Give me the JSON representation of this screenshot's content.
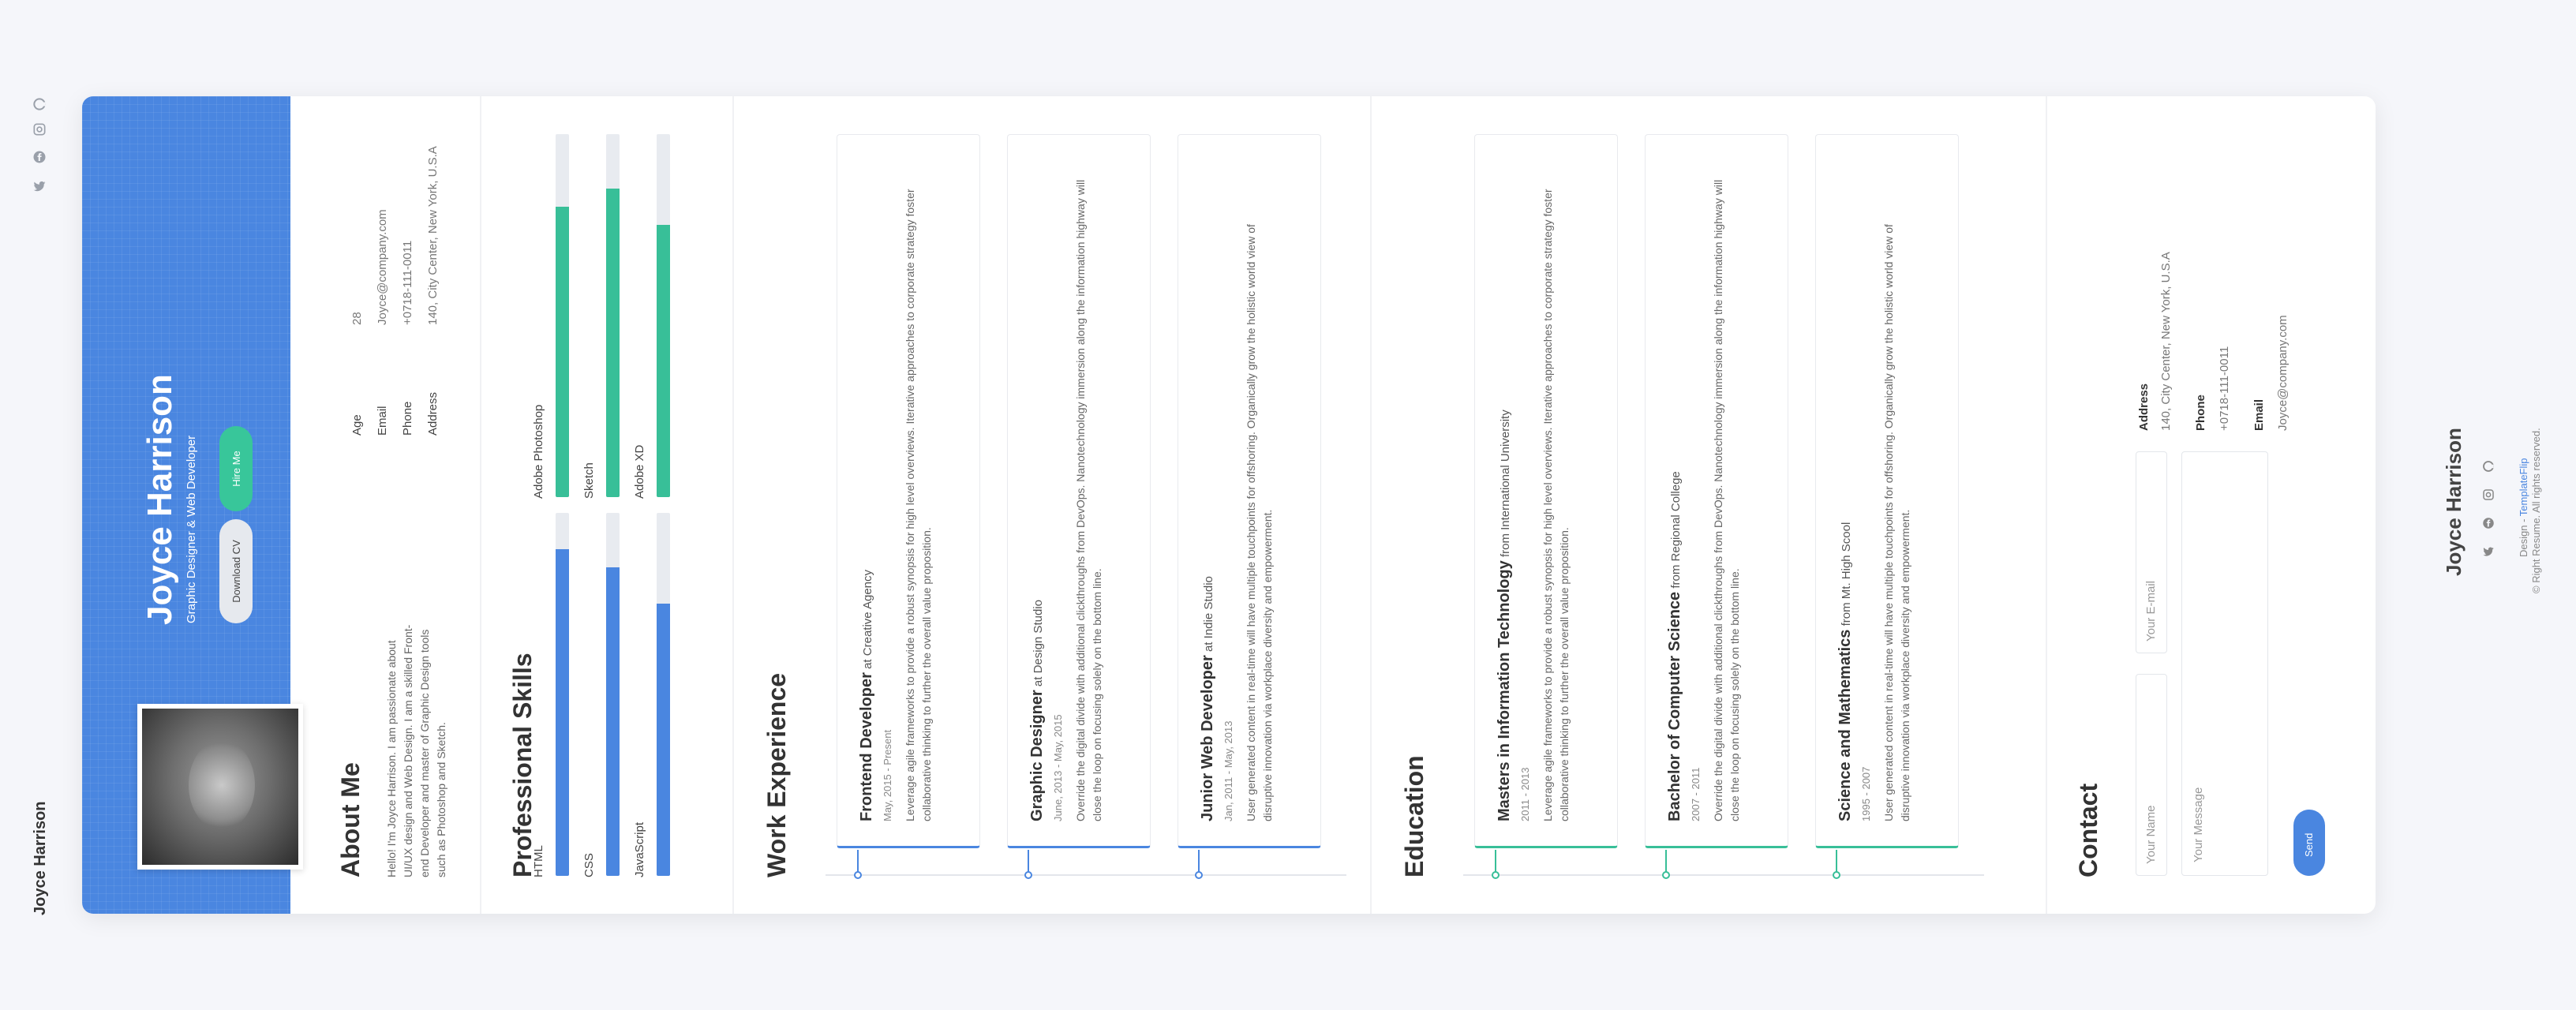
{
  "rail": {
    "name": "Joyce Harrison",
    "icons": [
      "chat-icon",
      "instagram-icon",
      "facebook-icon",
      "twitter-icon"
    ]
  },
  "hero": {
    "name": "Joyce Harrison",
    "subtitle": "Graphic Designer & Web Developer",
    "download_label": "Download CV",
    "hire_label": "Hire Me"
  },
  "about": {
    "title": "About Me",
    "text": "Hello! I'm Joyce Harrison. I am passionate about UI/UX design and Web Design. I am a skilled Front-end Developer and master of Graphic Design tools such as Photoshop and Sketch.",
    "info": [
      {
        "label": "Age",
        "value": "28"
      },
      {
        "label": "Email",
        "value": "Joyce@company.com"
      },
      {
        "label": "Phone",
        "value": "+0718-111-0011"
      },
      {
        "label": "Address",
        "value": "140, City Center, New York, U.S.A"
      }
    ]
  },
  "skills": {
    "title": "Professional Skills",
    "items": [
      {
        "label": "HTML",
        "percent": 90,
        "color": "#4a86e0"
      },
      {
        "label": "CSS",
        "percent": 85,
        "color": "#4a86e0"
      },
      {
        "label": "JavaScript",
        "percent": 75,
        "color": "#4a86e0"
      },
      {
        "label": "Adobe Photoshop",
        "percent": 80,
        "color": "#38bf98"
      },
      {
        "label": "Sketch",
        "percent": 85,
        "color": "#38bf98"
      },
      {
        "label": "Adobe XD",
        "percent": 75,
        "color": "#38bf98"
      }
    ]
  },
  "work": {
    "title": "Work Experience",
    "items": [
      {
        "role": "Frontend Developer",
        "at": "at",
        "org": "Creative Agency",
        "date": "May, 2015 - Present",
        "text": "Leverage agile frameworks to provide a robust synopsis for high level overviews. Iterative approaches to corporate strategy foster collaborative thinking to further the overall value proposition."
      },
      {
        "role": "Graphic Designer",
        "at": "at",
        "org": "Design Studio",
        "date": "June, 2013 - May, 2015",
        "text": "Override the digital divide with additional clickthroughs from DevOps. Nanotechnology immersion along the information highway will close the loop on focusing solely on the bottom line."
      },
      {
        "role": "Junior Web Developer",
        "at": "at",
        "org": "Indie Studio",
        "date": "Jan, 2011 - May, 2013",
        "text": "User generated content in real-time will have multiple touchpoints for offshoring. Organically grow the holistic world view of disruptive innovation via workplace diversity and empowerment."
      }
    ]
  },
  "education": {
    "title": "Education",
    "items": [
      {
        "role": "Masters in Information Technology",
        "at": "from",
        "org": "International University",
        "date": "2011 - 2013",
        "text": "Leverage agile frameworks to provide a robust synopsis for high level overviews. Iterative approaches to corporate strategy foster collaborative thinking to further the overall value proposition."
      },
      {
        "role": "Bachelor of Computer Science",
        "at": "from",
        "org": "Regional College",
        "date": "2007 - 2011",
        "text": "Override the digital divide with additional clickthroughs from DevOps. Nanotechnology immersion along the information highway will close the loop on focusing solely on the bottom line."
      },
      {
        "role": "Science and Mathematics",
        "at": "from",
        "org": "Mt. High Scool",
        "date": "1995 - 2007",
        "text": "User generated content in real-time will have multiple touchpoints for offshoring. Organically grow the holistic world view of disruptive innovation via workplace diversity and empowerment."
      }
    ]
  },
  "contact": {
    "title": "Contact",
    "name_placeholder": "Your Name",
    "email_placeholder": "Your E-mail",
    "message_placeholder": "Your Message",
    "send_label": "Send",
    "address_label": "Address",
    "address_value": "140, City Center, New York, U.S.A",
    "phone_label": "Phone",
    "phone_value": "+0718-111-0011",
    "email_label": "Email",
    "email_value": "Joyce@company.com"
  },
  "footer": {
    "name": "Joyce Harrison",
    "rights": "© Right Resume. All rights reserved.",
    "design_prefix": "Design - ",
    "design_link": "TemplateFlip"
  },
  "colors": {
    "accent_blue": "#4a86e0",
    "accent_green": "#38bf98"
  }
}
